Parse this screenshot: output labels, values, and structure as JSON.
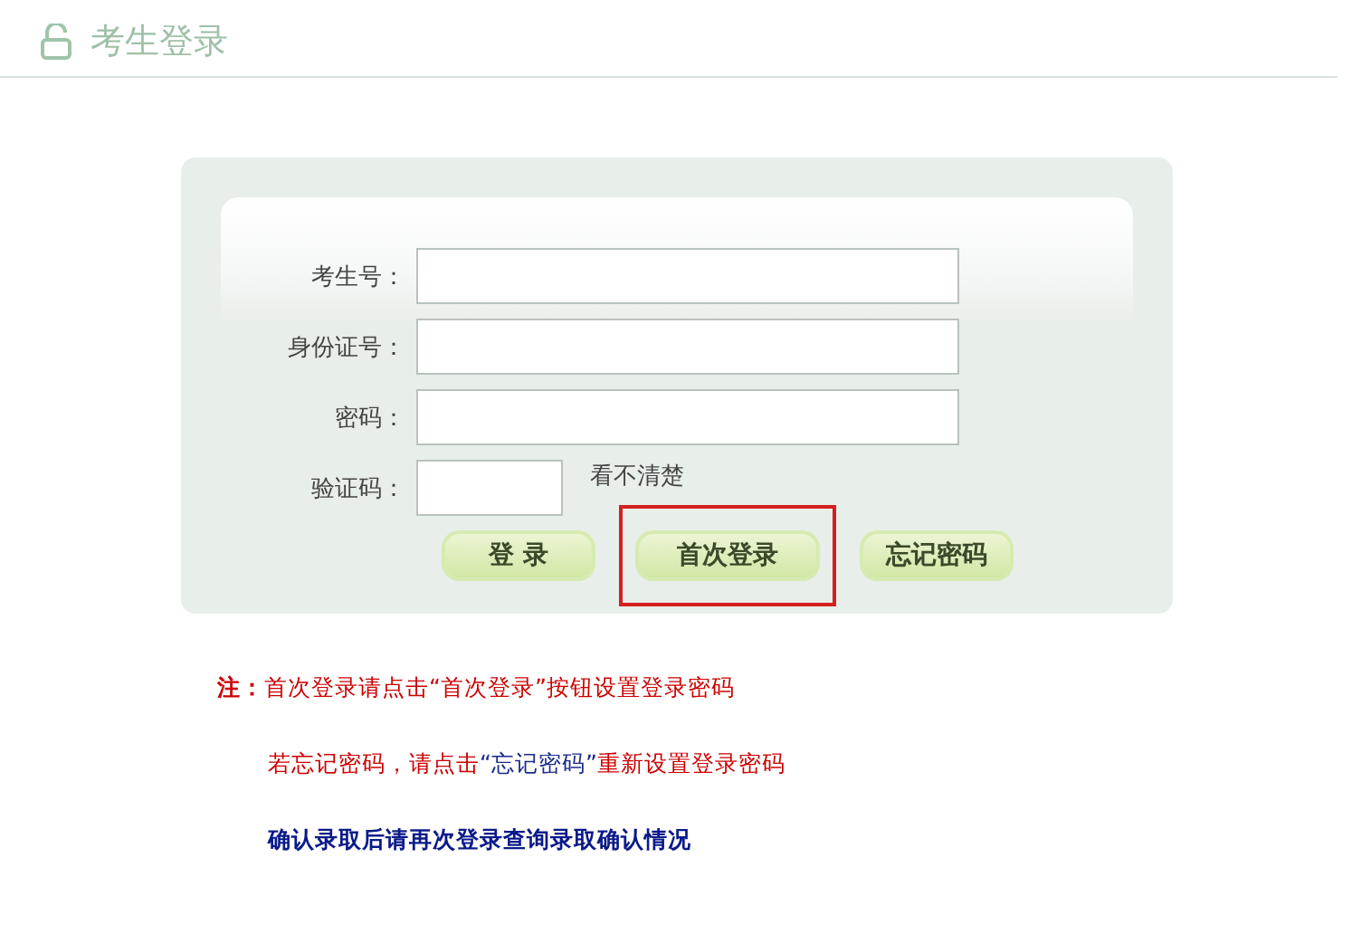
{
  "header": {
    "title": "考生登录"
  },
  "form": {
    "fields": [
      {
        "label": "考生号："
      },
      {
        "label": "身份证号："
      },
      {
        "label": "密码："
      }
    ],
    "captcha": {
      "label": "验证码：",
      "refresh_link": "看不清楚"
    },
    "buttons": [
      {
        "label": "登 录",
        "highlighted": false
      },
      {
        "label": "首次登录",
        "highlighted": true
      },
      {
        "label": "忘记密码",
        "highlighted": false
      }
    ]
  },
  "notes": [
    {
      "kind": "note",
      "segments": [
        {
          "text": "注：",
          "color": "#cc0000",
          "bold": true
        },
        {
          "text": "首次登录请点击“首次登录”按钮设置登录密码",
          "color": "#cc0000",
          "bold": false
        }
      ]
    },
    {
      "kind": "indent",
      "segments": [
        {
          "text": "若忘记密码，请点击",
          "color": "#cc0000",
          "bold": false
        },
        {
          "text": "“忘记密码”",
          "color": "#1a2a8a",
          "bold": false
        },
        {
          "text": "重新设置登录密码",
          "color": "#cc0000",
          "bold": false
        }
      ]
    },
    {
      "kind": "indent",
      "segments": [
        {
          "text": "确认录取后请再次登录查询录取确认情况",
          "color": "#0a1a8a",
          "bold": true
        }
      ]
    }
  ]
}
